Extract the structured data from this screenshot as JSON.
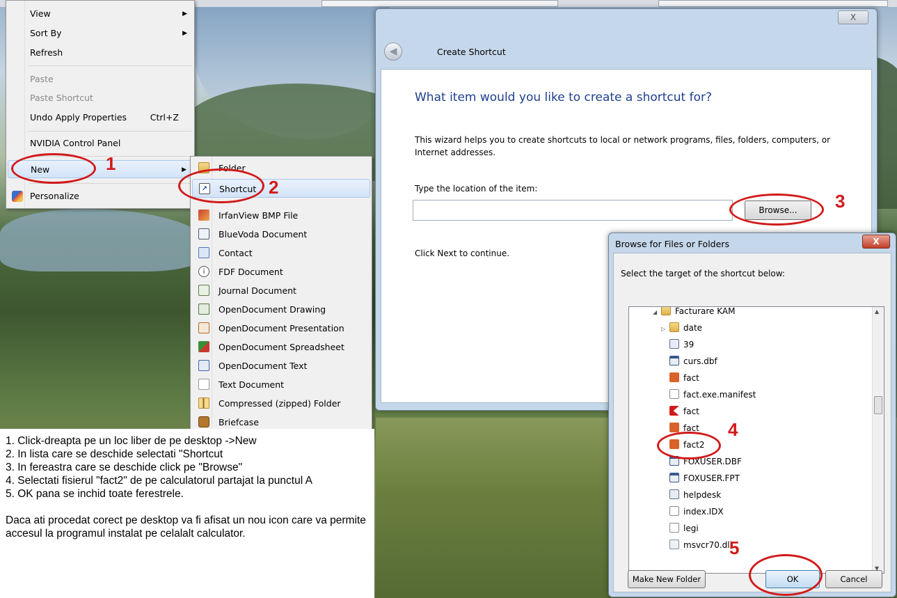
{
  "context_menu": {
    "items": [
      {
        "label": "View",
        "submenu": true
      },
      {
        "label": "Sort By",
        "submenu": true
      },
      {
        "label": "Refresh"
      },
      {
        "label": "Paste",
        "disabled": true
      },
      {
        "label": "Paste Shortcut",
        "disabled": true
      },
      {
        "label": "Undo Apply Properties",
        "shortcut": "Ctrl+Z"
      },
      {
        "label": "NVIDIA Control Panel"
      },
      {
        "label": "New",
        "submenu": true,
        "highlighted": true
      },
      {
        "label": "Personalize",
        "icon": "personalize-icon"
      }
    ]
  },
  "new_submenu": {
    "items": [
      {
        "label": "Folder",
        "icon": "folder-icon"
      },
      {
        "label": "Shortcut",
        "icon": "shortcut-icon",
        "highlighted": true
      },
      {
        "label": "IrfanView BMP File",
        "icon": "irfanview-icon"
      },
      {
        "label": "BlueVoda Document",
        "icon": "bluevoda-icon"
      },
      {
        "label": "Contact",
        "icon": "contact-icon"
      },
      {
        "label": "FDF Document",
        "icon": "fdf-icon"
      },
      {
        "label": "Journal Document",
        "icon": "journal-icon"
      },
      {
        "label": "OpenDocument Drawing",
        "icon": "odg-icon"
      },
      {
        "label": "OpenDocument Presentation",
        "icon": "odp-icon"
      },
      {
        "label": "OpenDocument Spreadsheet",
        "icon": "ods-icon"
      },
      {
        "label": "OpenDocument Text",
        "icon": "odt-icon"
      },
      {
        "label": "Text Document",
        "icon": "text-document-icon"
      },
      {
        "label": "Compressed (zipped) Folder",
        "icon": "zip-folder-icon"
      },
      {
        "label": "Briefcase",
        "icon": "briefcase-icon"
      }
    ]
  },
  "wizard": {
    "close_label": "X",
    "title": "Create Shortcut",
    "heading": "What item would you like to create a shortcut for?",
    "description": "This wizard helps you to create shortcuts to local or network programs, files, folders, computers, or Internet addresses.",
    "location_label": "Type the location of the item:",
    "location_value": "",
    "browse_label": "Browse...",
    "continue_text": "Click Next to continue."
  },
  "browse_dialog": {
    "title": "Browse for Files or Folders",
    "close_label": "X",
    "prompt": "Select the target of the shortcut below:",
    "tree": [
      {
        "label": "Facturare KAM",
        "icon": "folder-open-icon",
        "twisty": "expanded"
      },
      {
        "label": "date",
        "icon": "folder-icon",
        "twisty": "collapsed"
      },
      {
        "label": "39",
        "icon": "file-icon"
      },
      {
        "label": "curs.dbf",
        "icon": "database-file-icon"
      },
      {
        "label": "fact",
        "icon": "foxpro-icon"
      },
      {
        "label": "fact.exe.manifest",
        "icon": "file-icon"
      },
      {
        "label": "fact",
        "icon": "red-k-icon"
      },
      {
        "label": "fact",
        "icon": "foxpro-icon"
      },
      {
        "label": "fact2",
        "icon": "foxpro-icon"
      },
      {
        "label": "FOXUSER.DBF",
        "icon": "database-file-icon"
      },
      {
        "label": "FOXUSER.FPT",
        "icon": "database-file-icon"
      },
      {
        "label": "helpdesk",
        "icon": "text-file-icon"
      },
      {
        "label": "index.IDX",
        "icon": "file-icon"
      },
      {
        "label": "legi",
        "icon": "file-icon"
      },
      {
        "label": "msvcr70.dll",
        "icon": "dll-file-icon"
      }
    ],
    "make_new_folder_label": "Make New Folder",
    "ok_label": "OK",
    "cancel_label": "Cancel"
  },
  "annotations": {
    "step_labels": [
      "1",
      "2",
      "3",
      "4",
      "5"
    ],
    "color": "#d21a1a"
  },
  "instructions": {
    "lines": [
      "1. Click-dreapta pe un loc liber de pe desktop ->New",
      "2. In lista care se deschide selectati \"Shortcut",
      "3. In fereastra care se deschide click pe \"Browse\"",
      "4. Selectati fisierul \"fact2\" de pe calculatorul partajat la punctul A",
      "5. OK pana se inchid toate ferestrele."
    ],
    "note": "Daca ati procedat corect pe desktop va fi afisat un nou icon care va permite accesul la programul instalat pe celalalt calculator."
  }
}
